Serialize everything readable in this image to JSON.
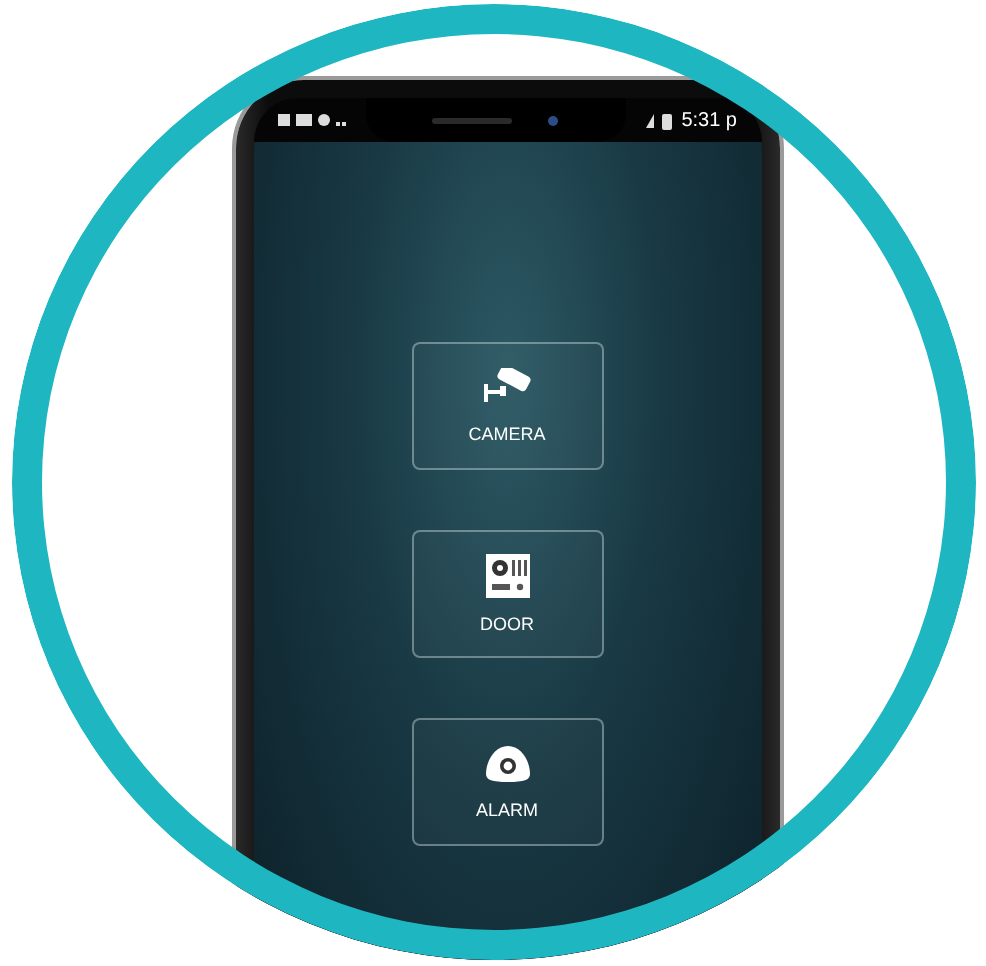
{
  "status_bar": {
    "time": "5:31 p"
  },
  "tiles": [
    {
      "kind": "camera",
      "label": "CAMERA"
    },
    {
      "kind": "door",
      "label": "DOOR"
    },
    {
      "kind": "alarm",
      "label": "ALARM"
    }
  ]
}
